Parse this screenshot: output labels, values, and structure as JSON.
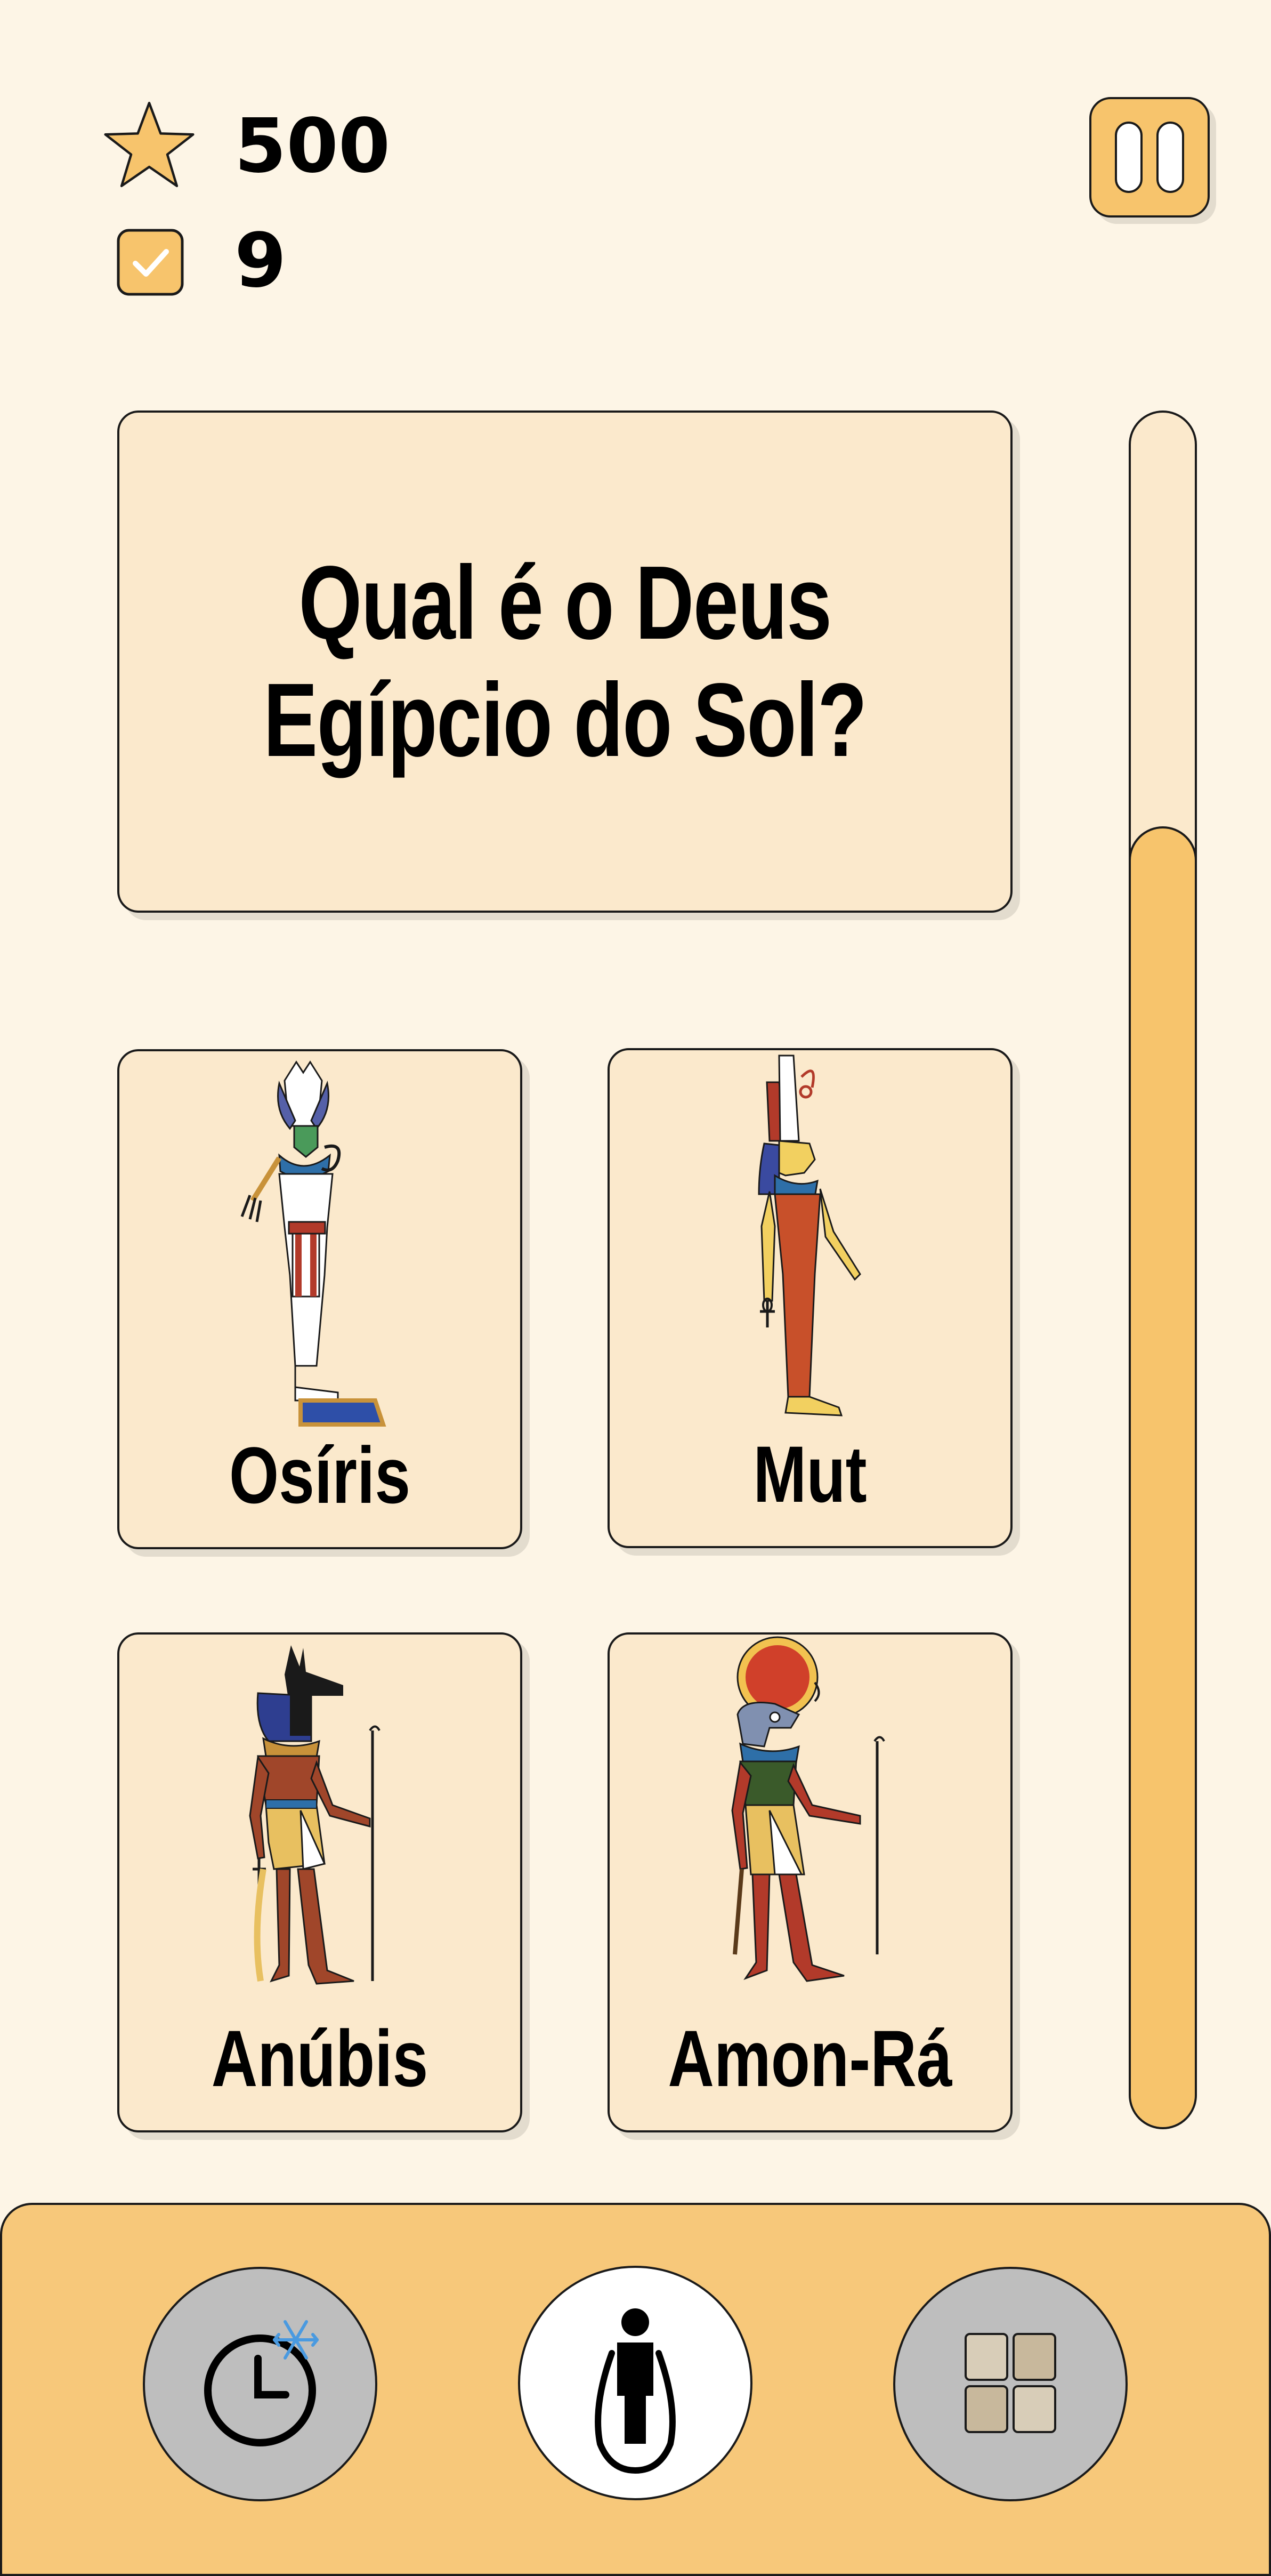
{
  "header": {
    "score": "500",
    "correct_count": "9",
    "score_icon": "star-icon",
    "correct_icon": "checkbox-checked-icon",
    "pause_icon": "pause-icon"
  },
  "question": {
    "line1": "Qual é o Deus",
    "line2": "Egípcio do Sol?"
  },
  "progress": {
    "fraction": 0.76
  },
  "answers": [
    {
      "label": "Osíris",
      "icon": "osiris-figure"
    },
    {
      "label": "Mut",
      "icon": "mut-figure"
    },
    {
      "label": "Anúbis",
      "icon": "anubis-figure"
    },
    {
      "label": "Amon-Rá",
      "icon": "amon-ra-figure"
    }
  ],
  "powerups": [
    {
      "icon": "freeze-timer-icon",
      "state": "disabled"
    },
    {
      "icon": "jump-rope-skip-icon",
      "state": "active"
    },
    {
      "icon": "fifty-fifty-grid-icon",
      "state": "disabled"
    }
  ],
  "colors": {
    "background": "#FDF5E6",
    "card": "#FBE9CC",
    "accent": "#F7C46C",
    "bottom_bar": "#F7C87A",
    "disabled": "#BEBEBE"
  }
}
